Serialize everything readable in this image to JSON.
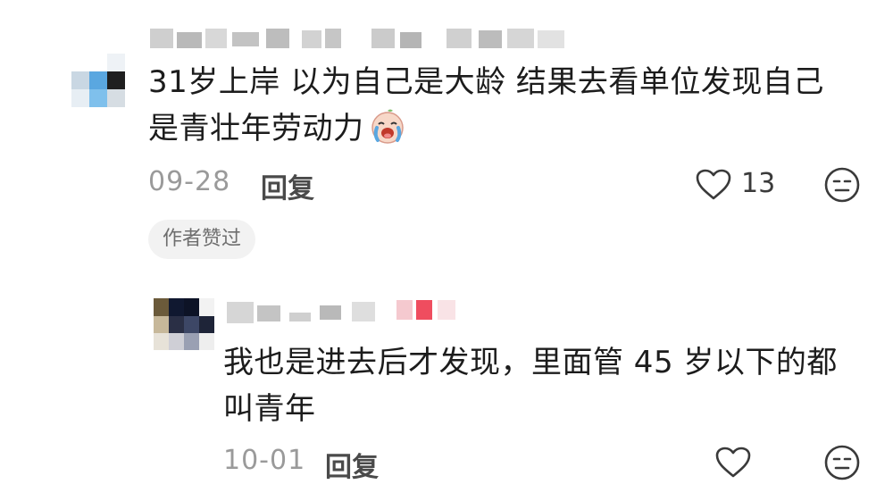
{
  "comments": [
    {
      "text_line1": "31岁上岸  以为自己是大龄 结果去看单位发现自己",
      "text_line2": "是青壮年劳动力",
      "emoji_icon": "crying-face-icon",
      "date": "09-28",
      "reply_label": "回复",
      "like_count": "13",
      "author_liked_badge": "作者赞过"
    }
  ],
  "replies": [
    {
      "text_line1": "我也是进去后才发现，里面管 45 岁以下的都",
      "text_line2": "叫青年",
      "date": "10-01",
      "reply_label": "回复"
    }
  ],
  "colors": {
    "text": "#1c1c1c",
    "muted": "#9a9a9a",
    "badge_bg": "#f2f2f2",
    "icon_stroke": "#3a3a3a"
  }
}
